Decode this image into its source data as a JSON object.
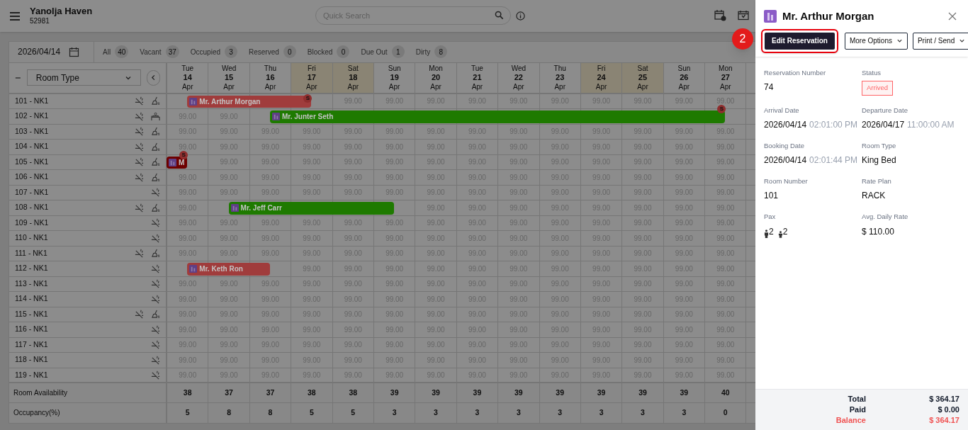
{
  "header": {
    "hotel_name": "Yanolja Haven",
    "hotel_code": "52981",
    "search": {
      "placeholder": "Quick Search"
    }
  },
  "toolbar": {
    "date": "2026/04/14",
    "filters": [
      {
        "label": "All",
        "count": "40"
      },
      {
        "label": "Vacant",
        "count": "37"
      },
      {
        "label": "Occupied",
        "count": "3"
      },
      {
        "label": "Reserved",
        "count": "0"
      },
      {
        "label": "Blocked",
        "count": "0"
      },
      {
        "label": "Due Out",
        "count": "1"
      },
      {
        "label": "Dirty",
        "count": "8"
      }
    ]
  },
  "grid": {
    "room_type_select": "Room Type",
    "days": [
      {
        "weekday": "Tue",
        "day": "14",
        "month": "Apr",
        "weekend": false
      },
      {
        "weekday": "Wed",
        "day": "15",
        "month": "Apr",
        "weekend": false
      },
      {
        "weekday": "Thu",
        "day": "16",
        "month": "Apr",
        "weekend": false
      },
      {
        "weekday": "Fri",
        "day": "17",
        "month": "Apr",
        "weekend": true
      },
      {
        "weekday": "Sat",
        "day": "18",
        "month": "Apr",
        "weekend": true
      },
      {
        "weekday": "Sun",
        "day": "19",
        "month": "Apr",
        "weekend": false
      },
      {
        "weekday": "Mon",
        "day": "20",
        "month": "Apr",
        "weekend": false
      },
      {
        "weekday": "Tue",
        "day": "21",
        "month": "Apr",
        "weekend": false
      },
      {
        "weekday": "Wed",
        "day": "22",
        "month": "Apr",
        "weekend": false
      },
      {
        "weekday": "Thu",
        "day": "23",
        "month": "Apr",
        "weekend": false
      },
      {
        "weekday": "Fri",
        "day": "24",
        "month": "Apr",
        "weekend": true
      },
      {
        "weekday": "Sat",
        "day": "25",
        "month": "Apr",
        "weekend": true
      },
      {
        "weekday": "Sun",
        "day": "26",
        "month": "Apr",
        "weekend": false
      },
      {
        "weekday": "Mon",
        "day": "27",
        "month": "Apr",
        "weekend": false
      }
    ],
    "rooms": [
      {
        "name": "101 - NK1",
        "non_smoking": true,
        "dirty": true,
        "inspect": false,
        "cells": [
          {
            "kind": "booked"
          },
          {
            "kind": "booked"
          },
          {
            "kind": "booked"
          },
          {
            "kind": "booked"
          },
          {
            "kind": "rate",
            "rate": "99.00"
          },
          {
            "kind": "rate",
            "rate": "99.00"
          },
          {
            "kind": "rate",
            "rate": "99.00"
          },
          {
            "kind": "rate",
            "rate": "99.00"
          },
          {
            "kind": "rate",
            "rate": "99.00"
          },
          {
            "kind": "rate",
            "rate": "99.00"
          },
          {
            "kind": "rate",
            "rate": "99.00"
          },
          {
            "kind": "rate",
            "rate": "99.00"
          },
          {
            "kind": "rate",
            "rate": "99.00"
          },
          {
            "kind": "rate",
            "rate": "99.00"
          }
        ],
        "booking": {
          "guest": "Mr. Arthur Morgan",
          "color": "#a03c3c",
          "badge": "S",
          "continues_before": false
        }
      },
      {
        "name": "102 - NK1",
        "non_smoking": true,
        "dirty": false,
        "inspect": true,
        "cells": [
          {
            "kind": "rate",
            "rate": "99.00"
          },
          {
            "kind": "rate",
            "rate": "99.00"
          },
          {
            "kind": "booked"
          },
          {
            "kind": "booked"
          },
          {
            "kind": "booked"
          },
          {
            "kind": "booked"
          },
          {
            "kind": "booked"
          },
          {
            "kind": "booked"
          },
          {
            "kind": "booked"
          },
          {
            "kind": "booked"
          },
          {
            "kind": "booked"
          },
          {
            "kind": "booked"
          },
          {
            "kind": "booked"
          },
          {
            "kind": "booked"
          }
        ],
        "booking": {
          "guest": "Mr. Junter Seth",
          "color": "#1e7a00",
          "badge": "S",
          "continues_before": false
        }
      },
      {
        "name": "103 - NK1",
        "non_smoking": true,
        "dirty": true,
        "inspect": false,
        "cells": [
          {
            "kind": "rate",
            "rate": "99.00"
          },
          {
            "kind": "rate",
            "rate": "99.00"
          },
          {
            "kind": "rate",
            "rate": "99.00"
          },
          {
            "kind": "rate",
            "rate": "99.00"
          },
          {
            "kind": "rate",
            "rate": "99.00"
          },
          {
            "kind": "rate",
            "rate": "99.00"
          },
          {
            "kind": "rate",
            "rate": "99.00"
          },
          {
            "kind": "rate",
            "rate": "99.00"
          },
          {
            "kind": "rate",
            "rate": "99.00"
          },
          {
            "kind": "rate",
            "rate": "99.00"
          },
          {
            "kind": "rate",
            "rate": "99.00"
          },
          {
            "kind": "rate",
            "rate": "99.00"
          },
          {
            "kind": "rate",
            "rate": "99.00"
          },
          {
            "kind": "rate",
            "rate": "99.00"
          }
        ]
      },
      {
        "name": "104 - NK1",
        "non_smoking": true,
        "dirty": true,
        "inspect": false,
        "cells": [
          {
            "kind": "rate",
            "rate": "99.00"
          },
          {
            "kind": "rate",
            "rate": "99.00"
          },
          {
            "kind": "rate",
            "rate": "99.00"
          },
          {
            "kind": "rate",
            "rate": "99.00"
          },
          {
            "kind": "rate",
            "rate": "99.00"
          },
          {
            "kind": "rate",
            "rate": "99.00"
          },
          {
            "kind": "rate",
            "rate": "99.00"
          },
          {
            "kind": "rate",
            "rate": "99.00"
          },
          {
            "kind": "rate",
            "rate": "99.00"
          },
          {
            "kind": "rate",
            "rate": "99.00"
          },
          {
            "kind": "rate",
            "rate": "99.00"
          },
          {
            "kind": "rate",
            "rate": "99.00"
          },
          {
            "kind": "rate",
            "rate": "99.00"
          },
          {
            "kind": "rate",
            "rate": "99.00"
          }
        ]
      },
      {
        "name": "105 - NK1",
        "non_smoking": true,
        "dirty": true,
        "inspect": false,
        "cells": [
          {
            "kind": "booked"
          },
          {
            "kind": "rate",
            "rate": "99.00"
          },
          {
            "kind": "rate",
            "rate": "99.00"
          },
          {
            "kind": "rate",
            "rate": "99.00"
          },
          {
            "kind": "rate",
            "rate": "99.00"
          },
          {
            "kind": "rate",
            "rate": "99.00"
          },
          {
            "kind": "rate",
            "rate": "99.00"
          },
          {
            "kind": "rate",
            "rate": "99.00"
          },
          {
            "kind": "rate",
            "rate": "99.00"
          },
          {
            "kind": "rate",
            "rate": "99.00"
          },
          {
            "kind": "rate",
            "rate": "99.00"
          },
          {
            "kind": "rate",
            "rate": "99.00"
          },
          {
            "kind": "rate",
            "rate": "99.00"
          },
          {
            "kind": "rate",
            "rate": "99.00"
          }
        ],
        "booking": {
          "guest": "M",
          "color": "#6e0000",
          "badge": "S",
          "continues_before": true
        }
      },
      {
        "name": "106 - NK1",
        "non_smoking": true,
        "dirty": true,
        "inspect": false,
        "cells": [
          {
            "kind": "rate",
            "rate": "99.00"
          },
          {
            "kind": "rate",
            "rate": "99.00"
          },
          {
            "kind": "rate",
            "rate": "99.00"
          },
          {
            "kind": "rate",
            "rate": "99.00"
          },
          {
            "kind": "rate",
            "rate": "99.00"
          },
          {
            "kind": "rate",
            "rate": "99.00"
          },
          {
            "kind": "rate",
            "rate": "99.00"
          },
          {
            "kind": "rate",
            "rate": "99.00"
          },
          {
            "kind": "rate",
            "rate": "99.00"
          },
          {
            "kind": "rate",
            "rate": "99.00"
          },
          {
            "kind": "rate",
            "rate": "99.00"
          },
          {
            "kind": "rate",
            "rate": "99.00"
          },
          {
            "kind": "rate",
            "rate": "99.00"
          },
          {
            "kind": "rate",
            "rate": "99.00"
          }
        ]
      },
      {
        "name": "107 - NK1",
        "non_smoking": true,
        "dirty": false,
        "inspect": false,
        "cells": [
          {
            "kind": "rate",
            "rate": "99.00"
          },
          {
            "kind": "rate",
            "rate": "99.00"
          },
          {
            "kind": "rate",
            "rate": "99.00"
          },
          {
            "kind": "rate",
            "rate": "99.00"
          },
          {
            "kind": "rate",
            "rate": "99.00"
          },
          {
            "kind": "rate",
            "rate": "99.00"
          },
          {
            "kind": "rate",
            "rate": "99.00"
          },
          {
            "kind": "rate",
            "rate": "99.00"
          },
          {
            "kind": "rate",
            "rate": "99.00"
          },
          {
            "kind": "rate",
            "rate": "99.00"
          },
          {
            "kind": "rate",
            "rate": "99.00"
          },
          {
            "kind": "rate",
            "rate": "99.00"
          },
          {
            "kind": "rate",
            "rate": "99.00"
          },
          {
            "kind": "rate",
            "rate": "99.00"
          }
        ]
      },
      {
        "name": "108 - NK1",
        "non_smoking": true,
        "dirty": true,
        "inspect": false,
        "cells": [
          {
            "kind": "rate",
            "rate": "99.00"
          },
          {
            "kind": "booked"
          },
          {
            "kind": "booked"
          },
          {
            "kind": "booked"
          },
          {
            "kind": "booked"
          },
          {
            "kind": "booked"
          },
          {
            "kind": "rate",
            "rate": "99.00"
          },
          {
            "kind": "rate",
            "rate": "99.00"
          },
          {
            "kind": "rate",
            "rate": "99.00"
          },
          {
            "kind": "rate",
            "rate": "99.00"
          },
          {
            "kind": "rate",
            "rate": "99.00"
          },
          {
            "kind": "rate",
            "rate": "99.00"
          },
          {
            "kind": "rate",
            "rate": "99.00"
          },
          {
            "kind": "rate",
            "rate": "99.00"
          }
        ],
        "booking": {
          "guest": "Mr. Jeff Carr",
          "color": "#1e7a00",
          "continues_before": false
        }
      },
      {
        "name": "109 - NK1",
        "non_smoking": true,
        "dirty": false,
        "inspect": false,
        "cells": [
          {
            "kind": "rate",
            "rate": "99.00"
          },
          {
            "kind": "rate",
            "rate": "99.00"
          },
          {
            "kind": "rate",
            "rate": "99.00"
          },
          {
            "kind": "rate",
            "rate": "99.00"
          },
          {
            "kind": "rate",
            "rate": "99.00"
          },
          {
            "kind": "rate",
            "rate": "99.00"
          },
          {
            "kind": "rate",
            "rate": "99.00"
          },
          {
            "kind": "rate",
            "rate": "99.00"
          },
          {
            "kind": "rate",
            "rate": "99.00"
          },
          {
            "kind": "rate",
            "rate": "99.00"
          },
          {
            "kind": "rate",
            "rate": "99.00"
          },
          {
            "kind": "rate",
            "rate": "99.00"
          },
          {
            "kind": "rate",
            "rate": "99.00"
          },
          {
            "kind": "rate",
            "rate": "99.00"
          }
        ]
      },
      {
        "name": "110 - NK1",
        "non_smoking": true,
        "dirty": false,
        "inspect": false,
        "cells": [
          {
            "kind": "rate",
            "rate": "99.00"
          },
          {
            "kind": "rate",
            "rate": "99.00"
          },
          {
            "kind": "rate",
            "rate": "99.00"
          },
          {
            "kind": "rate",
            "rate": "99.00"
          },
          {
            "kind": "rate",
            "rate": "99.00"
          },
          {
            "kind": "rate",
            "rate": "99.00"
          },
          {
            "kind": "rate",
            "rate": "99.00"
          },
          {
            "kind": "rate",
            "rate": "99.00"
          },
          {
            "kind": "rate",
            "rate": "99.00"
          },
          {
            "kind": "rate",
            "rate": "99.00"
          },
          {
            "kind": "rate",
            "rate": "99.00"
          },
          {
            "kind": "rate",
            "rate": "99.00"
          },
          {
            "kind": "rate",
            "rate": "99.00"
          },
          {
            "kind": "rate",
            "rate": "99.00"
          }
        ]
      },
      {
        "name": "111 - NK1",
        "non_smoking": true,
        "dirty": true,
        "inspect": false,
        "cells": [
          {
            "kind": "rate",
            "rate": "99.00"
          },
          {
            "kind": "rate",
            "rate": "99.00"
          },
          {
            "kind": "rate",
            "rate": "99.00"
          },
          {
            "kind": "rate",
            "rate": "99.00"
          },
          {
            "kind": "rate",
            "rate": "99.00"
          },
          {
            "kind": "rate",
            "rate": "99.00"
          },
          {
            "kind": "rate",
            "rate": "99.00"
          },
          {
            "kind": "rate",
            "rate": "99.00"
          },
          {
            "kind": "rate",
            "rate": "99.00"
          },
          {
            "kind": "rate",
            "rate": "99.00"
          },
          {
            "kind": "rate",
            "rate": "99.00"
          },
          {
            "kind": "rate",
            "rate": "99.00"
          },
          {
            "kind": "rate",
            "rate": "99.00"
          },
          {
            "kind": "rate",
            "rate": "99.00"
          }
        ]
      },
      {
        "name": "112 - NK1",
        "non_smoking": true,
        "dirty": false,
        "inspect": false,
        "cells": [
          {
            "kind": "booked"
          },
          {
            "kind": "booked"
          },
          {
            "kind": "booked"
          },
          {
            "kind": "rate",
            "rate": "99.00"
          },
          {
            "kind": "rate",
            "rate": "99.00"
          },
          {
            "kind": "rate",
            "rate": "99.00"
          },
          {
            "kind": "rate",
            "rate": "99.00"
          },
          {
            "kind": "rate",
            "rate": "99.00"
          },
          {
            "kind": "rate",
            "rate": "99.00"
          },
          {
            "kind": "rate",
            "rate": "99.00"
          },
          {
            "kind": "rate",
            "rate": "99.00"
          },
          {
            "kind": "rate",
            "rate": "99.00"
          },
          {
            "kind": "rate",
            "rate": "99.00"
          },
          {
            "kind": "rate",
            "rate": "99.00"
          }
        ],
        "booking": {
          "guest": "Mr. Keth Ron",
          "color": "#a03c3c",
          "continues_before": false
        }
      },
      {
        "name": "113 - NK1",
        "non_smoking": true,
        "dirty": false,
        "inspect": false,
        "cells": [
          {
            "kind": "rate",
            "rate": "99.00"
          },
          {
            "kind": "rate",
            "rate": "99.00"
          },
          {
            "kind": "rate",
            "rate": "99.00"
          },
          {
            "kind": "rate",
            "rate": "99.00"
          },
          {
            "kind": "rate",
            "rate": "99.00"
          },
          {
            "kind": "rate",
            "rate": "99.00"
          },
          {
            "kind": "rate",
            "rate": "99.00"
          },
          {
            "kind": "rate",
            "rate": "99.00"
          },
          {
            "kind": "rate",
            "rate": "99.00"
          },
          {
            "kind": "rate",
            "rate": "99.00"
          },
          {
            "kind": "rate",
            "rate": "99.00"
          },
          {
            "kind": "rate",
            "rate": "99.00"
          },
          {
            "kind": "rate",
            "rate": "99.00"
          },
          {
            "kind": "rate",
            "rate": "99.00"
          }
        ]
      },
      {
        "name": "114 - NK1",
        "non_smoking": true,
        "dirty": false,
        "inspect": false,
        "cells": [
          {
            "kind": "rate",
            "rate": "99.00"
          },
          {
            "kind": "rate",
            "rate": "99.00"
          },
          {
            "kind": "rate",
            "rate": "99.00"
          },
          {
            "kind": "rate",
            "rate": "99.00"
          },
          {
            "kind": "rate",
            "rate": "99.00"
          },
          {
            "kind": "rate",
            "rate": "99.00"
          },
          {
            "kind": "rate",
            "rate": "99.00"
          },
          {
            "kind": "rate",
            "rate": "99.00"
          },
          {
            "kind": "rate",
            "rate": "99.00"
          },
          {
            "kind": "rate",
            "rate": "99.00"
          },
          {
            "kind": "rate",
            "rate": "99.00"
          },
          {
            "kind": "rate",
            "rate": "99.00"
          },
          {
            "kind": "rate",
            "rate": "99.00"
          },
          {
            "kind": "rate",
            "rate": "99.00"
          }
        ]
      },
      {
        "name": "115 - NK1",
        "non_smoking": true,
        "dirty": true,
        "inspect": false,
        "cells": [
          {
            "kind": "rate",
            "rate": "99.00"
          },
          {
            "kind": "rate",
            "rate": "99.00"
          },
          {
            "kind": "rate",
            "rate": "99.00"
          },
          {
            "kind": "rate",
            "rate": "99.00"
          },
          {
            "kind": "rate",
            "rate": "99.00"
          },
          {
            "kind": "rate",
            "rate": "99.00"
          },
          {
            "kind": "rate",
            "rate": "99.00"
          },
          {
            "kind": "rate",
            "rate": "99.00"
          },
          {
            "kind": "rate",
            "rate": "99.00"
          },
          {
            "kind": "rate",
            "rate": "99.00"
          },
          {
            "kind": "rate",
            "rate": "99.00"
          },
          {
            "kind": "rate",
            "rate": "99.00"
          },
          {
            "kind": "rate",
            "rate": "99.00"
          },
          {
            "kind": "rate",
            "rate": "99.00"
          }
        ]
      },
      {
        "name": "116 - NK1",
        "non_smoking": true,
        "dirty": false,
        "inspect": false,
        "cells": [
          {
            "kind": "rate",
            "rate": "99.00"
          },
          {
            "kind": "rate",
            "rate": "99.00"
          },
          {
            "kind": "rate",
            "rate": "99.00"
          },
          {
            "kind": "rate",
            "rate": "99.00"
          },
          {
            "kind": "rate",
            "rate": "99.00"
          },
          {
            "kind": "rate",
            "rate": "99.00"
          },
          {
            "kind": "rate",
            "rate": "99.00"
          },
          {
            "kind": "rate",
            "rate": "99.00"
          },
          {
            "kind": "rate",
            "rate": "99.00"
          },
          {
            "kind": "rate",
            "rate": "99.00"
          },
          {
            "kind": "rate",
            "rate": "99.00"
          },
          {
            "kind": "rate",
            "rate": "99.00"
          },
          {
            "kind": "rate",
            "rate": "99.00"
          },
          {
            "kind": "rate",
            "rate": "99.00"
          }
        ]
      },
      {
        "name": "117 - NK1",
        "non_smoking": true,
        "dirty": false,
        "inspect": false,
        "cells": [
          {
            "kind": "rate",
            "rate": "99.00"
          },
          {
            "kind": "rate",
            "rate": "99.00"
          },
          {
            "kind": "rate",
            "rate": "99.00"
          },
          {
            "kind": "rate",
            "rate": "99.00"
          },
          {
            "kind": "rate",
            "rate": "99.00"
          },
          {
            "kind": "rate",
            "rate": "99.00"
          },
          {
            "kind": "rate",
            "rate": "99.00"
          },
          {
            "kind": "rate",
            "rate": "99.00"
          },
          {
            "kind": "rate",
            "rate": "99.00"
          },
          {
            "kind": "rate",
            "rate": "99.00"
          },
          {
            "kind": "rate",
            "rate": "99.00"
          },
          {
            "kind": "rate",
            "rate": "99.00"
          },
          {
            "kind": "rate",
            "rate": "99.00"
          },
          {
            "kind": "rate",
            "rate": "99.00"
          }
        ]
      },
      {
        "name": "118 - NK1",
        "non_smoking": true,
        "dirty": false,
        "inspect": false,
        "cells": [
          {
            "kind": "rate",
            "rate": "99.00"
          },
          {
            "kind": "rate",
            "rate": "99.00"
          },
          {
            "kind": "rate",
            "rate": "99.00"
          },
          {
            "kind": "rate",
            "rate": "99.00"
          },
          {
            "kind": "rate",
            "rate": "99.00"
          },
          {
            "kind": "rate",
            "rate": "99.00"
          },
          {
            "kind": "rate",
            "rate": "99.00"
          },
          {
            "kind": "rate",
            "rate": "99.00"
          },
          {
            "kind": "rate",
            "rate": "99.00"
          },
          {
            "kind": "rate",
            "rate": "99.00"
          },
          {
            "kind": "rate",
            "rate": "99.00"
          },
          {
            "kind": "rate",
            "rate": "99.00"
          },
          {
            "kind": "rate",
            "rate": "99.00"
          },
          {
            "kind": "rate",
            "rate": "99.00"
          }
        ]
      },
      {
        "name": "119 - NK1",
        "non_smoking": true,
        "dirty": false,
        "inspect": false,
        "cells": [
          {
            "kind": "rate",
            "rate": "99.00"
          },
          {
            "kind": "rate",
            "rate": "99.00"
          },
          {
            "kind": "rate",
            "rate": "99.00"
          },
          {
            "kind": "rate",
            "rate": "99.00"
          },
          {
            "kind": "rate",
            "rate": "99.00"
          },
          {
            "kind": "rate",
            "rate": "99.00"
          },
          {
            "kind": "rate",
            "rate": "99.00"
          },
          {
            "kind": "rate",
            "rate": "99.00"
          },
          {
            "kind": "rate",
            "rate": "99.00"
          },
          {
            "kind": "rate",
            "rate": "99.00"
          },
          {
            "kind": "rate",
            "rate": "99.00"
          },
          {
            "kind": "rate",
            "rate": "99.00"
          },
          {
            "kind": "rate",
            "rate": "99.00"
          },
          {
            "kind": "rate",
            "rate": "99.00"
          }
        ]
      }
    ],
    "totals": [
      {
        "label": "Room Availability",
        "values": [
          "38",
          "37",
          "37",
          "38",
          "38",
          "39",
          "39",
          "39",
          "39",
          "39",
          "39",
          "39",
          "39",
          "40"
        ]
      },
      {
        "label": "Occupancy(%)",
        "values": [
          "5",
          "8",
          "8",
          "5",
          "5",
          "3",
          "3",
          "3",
          "3",
          "3",
          "3",
          "3",
          "3",
          "0"
        ]
      }
    ]
  },
  "step_marker": "2",
  "panel": {
    "guest": "Mr. Arthur Morgan",
    "buttons": [
      {
        "label": "Edit Reservation",
        "kind": "primary",
        "highlighted": true
      },
      {
        "label": "More Options",
        "kind": "dropdown",
        "highlighted": false
      },
      {
        "label": "Print / Send",
        "kind": "dropdown",
        "highlighted": false
      }
    ],
    "fields": [
      {
        "label": "Reservation Number",
        "value": "74"
      },
      {
        "label": "Status",
        "value": "Arrived",
        "kind": "status"
      },
      {
        "label": "Arrival Date",
        "value": "2026/04/14",
        "time": "02:01:00 PM"
      },
      {
        "label": "Departure Date",
        "value": "2026/04/17",
        "time": "11:00:00 AM"
      },
      {
        "label": "Booking Date",
        "value": "2026/04/14",
        "time": "02:01:44 PM"
      },
      {
        "label": "Room Type",
        "value": "King Bed"
      },
      {
        "label": "Room Number",
        "value": "101"
      },
      {
        "label": "Rate Plan",
        "value": "RACK"
      },
      {
        "label": "Pax",
        "kind": "pax",
        "adults": "2",
        "children": "2"
      },
      {
        "label": "Avg. Daily Rate",
        "value": "$ 110.00"
      }
    ],
    "summary": [
      {
        "label": "Total",
        "value": "$ 364.17",
        "alert": false
      },
      {
        "label": "Paid",
        "value": "$ 0.00",
        "alert": false
      },
      {
        "label": "Balance",
        "value": "$ 364.17",
        "alert": true
      }
    ]
  }
}
